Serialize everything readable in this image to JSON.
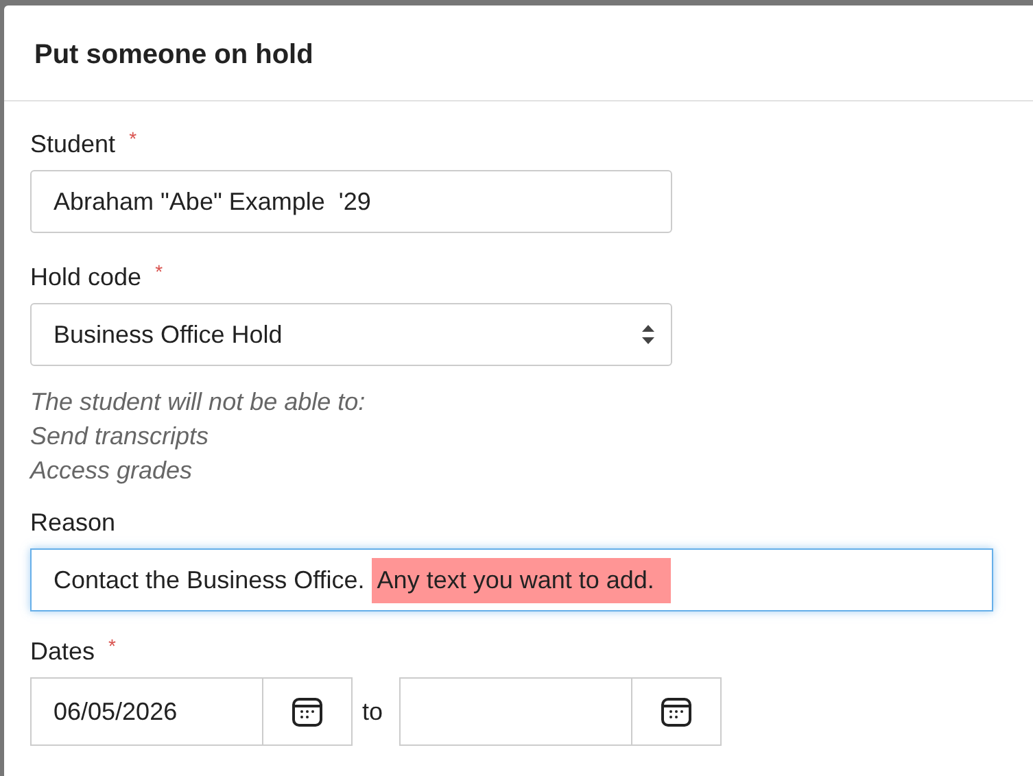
{
  "dialog": {
    "title": "Put someone on hold"
  },
  "fields": [
    {
      "kind": "text",
      "label": "Student",
      "required_mark": "*",
      "value": "Abraham \"Abe\" Example  '29"
    },
    {
      "kind": "select",
      "label": "Hold code",
      "required_mark": "*",
      "value": "Business Office Hold",
      "notes": [
        "The student will not be able to:",
        "Send transcripts",
        "Access grades"
      ]
    },
    {
      "kind": "reason",
      "label": "Reason",
      "focused": true,
      "value": "Contact the Business Office.",
      "highlighted_text": "Any text you want to add."
    },
    {
      "kind": "daterange",
      "label": "Dates",
      "required_mark": "*",
      "start": "06/05/2026",
      "separator": "to"
    }
  ]
}
